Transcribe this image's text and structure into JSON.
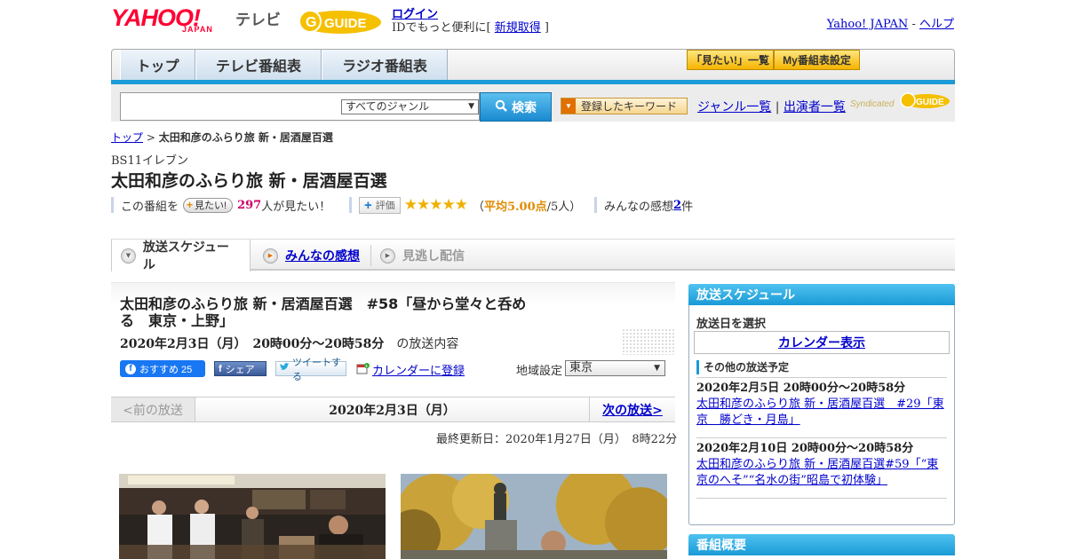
{
  "header": {
    "logo_yahoo": "YAHOO!",
    "logo_japan": "JAPAN",
    "logo_tv": "テレビ",
    "logo_gguide": "GUIDE",
    "login": "ログイン",
    "login_sub_prefix": "IDでもっと便利に[ ",
    "signup": "新規取得",
    "login_sub_suffix": " ]",
    "yahoo_japan_link": "Yahoo! JAPAN",
    "dash": " - ",
    "help_link": "ヘルプ"
  },
  "nav": {
    "tabs": [
      "トップ",
      "テレビ番組表",
      "ラジオ番組表"
    ],
    "mitai_list": "「見たい!」一覧",
    "my_schedule": "My番組表設定"
  },
  "search": {
    "placeholder": "",
    "genre_selected": "すべてのジャンル",
    "button": "検索",
    "keyword_button": "登録したキーワード",
    "genre_list": "ジャンル一覧",
    "divider": " | ",
    "cast_list": "出演者一覧",
    "syndicated": "Syndicated",
    "syndicated_logo": "GUIDE"
  },
  "breadcrumb": {
    "top": "トップ",
    "sep": " > ",
    "current": "太田和彦のふらり旅 新・居酒屋百選"
  },
  "program": {
    "channel": "BS11イレブン",
    "title": "太田和彦のふらり旅 新・居酒屋百選",
    "want_prefix": "この番組を",
    "want_button": "見たい!",
    "want_count": "297",
    "want_suffix": "人が見たい！",
    "rating_button": "評価",
    "stars": "★★★★★",
    "avg_open": "（",
    "avg": "平均5.00点",
    "avg_count": "/5人）",
    "reviews_label": "みんなの感想 ",
    "reviews_count": "2",
    "reviews_suffix": "件"
  },
  "schedule_tabs": [
    {
      "label": "放送スケジュール",
      "state": "active"
    },
    {
      "label": "みんなの感想",
      "state": "link"
    },
    {
      "label": "見逃し配信",
      "state": "disabled"
    }
  ],
  "episode": {
    "title": "太田和彦のふらり旅 新・居酒屋百選　#58「昼から堂々と呑める　東京・上野」",
    "date": "2020年2月3日（月）　20時00分～20時58分",
    "date_suffix": "の放送内容",
    "fb_recommend": "おすすめ 25",
    "fb_share": "シェア",
    "tweet": "ツイートする",
    "calendar_register": "カレンダーに登録",
    "region_label": "地域設定",
    "region_selected": "東京",
    "prev": "<前の放送",
    "current_date": "2020年2月3日（月）",
    "next": "次の放送>",
    "updated": "最終更新日：2020年1月27日（月）　8時22分"
  },
  "sidebar": {
    "schedule_heading": "放送スケジュール",
    "select_date": "放送日を選択",
    "calendar_button": "カレンダー表示",
    "other_heading": "その他の放送予定",
    "items": [
      {
        "date": "2020年2月5日 20時00分～20時58分",
        "title": "太田和彦のふらり旅 新・居酒屋百選　#29「東京　勝どき・月島」"
      },
      {
        "date": "2020年2月10日 20時00分～20時58分",
        "title": "太田和彦のふらり旅 新・居酒屋百選#59「“東京のへそ”“名水の街”昭島で初体験」"
      }
    ],
    "overview_heading": "番組概要"
  },
  "colors": {
    "accent": "#1a9ad6",
    "link": "#0000cc",
    "yahoo_red": "#ff0033",
    "gguide_yellow": "#f5c000",
    "star": "#f0b000",
    "pink": "#cc0066"
  }
}
